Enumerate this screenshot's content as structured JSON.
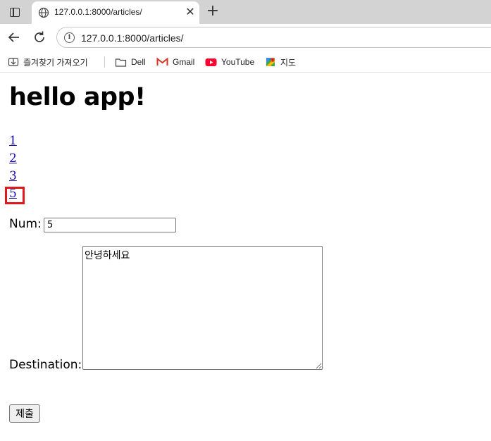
{
  "browser": {
    "tab_title": "127.0.0.1:8000/articles/",
    "url": "127.0.0.1:8000/articles/",
    "bookmarks": [
      {
        "label": "즐겨찾기 가져오기",
        "icon": "import-bookmarks-icon"
      },
      {
        "label": "Dell",
        "icon": "folder-icon"
      },
      {
        "label": "Gmail",
        "icon": "gmail-icon"
      },
      {
        "label": "YouTube",
        "icon": "youtube-icon"
      },
      {
        "label": "지도",
        "icon": "maps-icon"
      }
    ]
  },
  "page": {
    "heading": "hello app!",
    "articles": [
      "1",
      "2",
      "3",
      "5"
    ],
    "highlighted_article": "5",
    "form": {
      "num_label": "Num:",
      "num_value": "5",
      "destination_label": "Destination:",
      "destination_value": "안녕하세요",
      "submit_label": "제출"
    }
  },
  "colors": {
    "tabbar": "#d3d3d3",
    "link": "#1a0dab",
    "highlight": "#e0171b"
  }
}
